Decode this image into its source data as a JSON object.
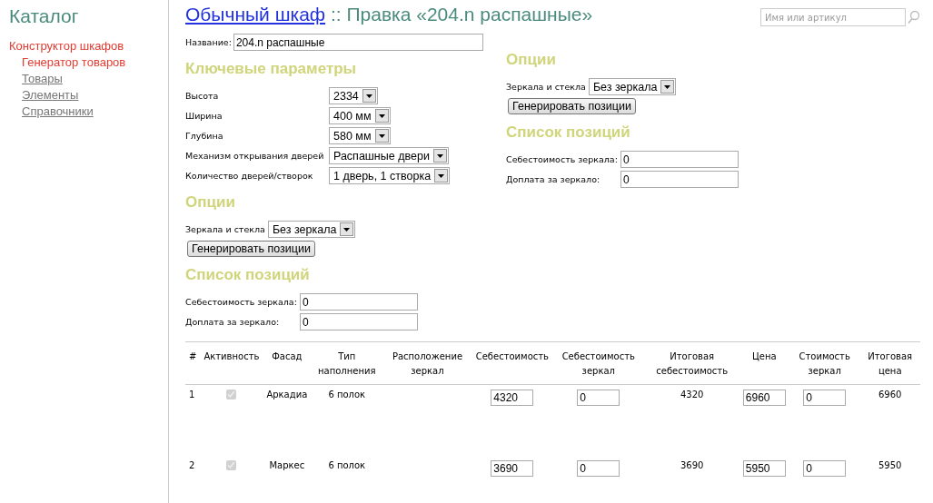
{
  "sidebar": {
    "title": "Каталог",
    "items": [
      {
        "label": "Конструктор шкафов",
        "selected": true,
        "children": [
          {
            "label": "Генератор товаров",
            "selected": true
          },
          {
            "label": "Товары",
            "selected": false
          },
          {
            "label": "Элементы",
            "selected": false
          },
          {
            "label": "Справочники",
            "selected": false
          }
        ]
      }
    ]
  },
  "header": {
    "link": "Обычный шкаф",
    "title": " :: Правка «204.n распашные»"
  },
  "search": {
    "placeholder": "Имя или артикул"
  },
  "name_field": {
    "label": "Название:",
    "value": "204.n распашные"
  },
  "columns": [
    {
      "sections": [
        {
          "heading": "Ключевые параметры",
          "kind": "params",
          "fields": [
            {
              "kind": "select",
              "label": "Высота",
              "value": "2334"
            },
            {
              "kind": "select",
              "label": "Ширина",
              "value": "400 мм"
            },
            {
              "kind": "select",
              "label": "Глубина",
              "value": "580 мм"
            },
            {
              "kind": "select",
              "label": "Механизм открывания дверей",
              "value": "Распашные двери"
            },
            {
              "kind": "select",
              "label": "Количество дверей/створок",
              "value": "1 дверь, 1 створка"
            }
          ]
        },
        {
          "heading": "Опции",
          "kind": "options",
          "fields": [
            {
              "kind": "select",
              "label": "Зеркала и стекла",
              "value": "Без зеркала"
            }
          ],
          "button": "Генерировать позиции"
        },
        {
          "heading": "Список позиций",
          "kind": "costs",
          "fields": [
            {
              "kind": "input",
              "label": "Себестоимость зеркала:",
              "value": "0"
            },
            {
              "kind": "input",
              "label": "Доплата за зеркало:",
              "value": "0"
            }
          ]
        }
      ]
    },
    {
      "sections": [
        {
          "heading": "Опции",
          "kind": "options",
          "fields": [
            {
              "kind": "select",
              "label": "Зеркала и стекла",
              "value": "Без зеркала"
            }
          ],
          "button": "Генерировать позиции"
        },
        {
          "heading": "Список позиций",
          "kind": "costs",
          "fields": [
            {
              "kind": "input",
              "label": "Себестоимость зеркала:",
              "value": "0"
            },
            {
              "kind": "input",
              "label": "Доплата за зеркало:",
              "value": "0"
            }
          ]
        }
      ]
    }
  ],
  "table": {
    "columns": [
      "#",
      "Активность",
      "Фасад",
      "Тип наполнения",
      "Расположение зеркал",
      "Себестоимость",
      "Себестоимость зеркал",
      "Итоговая себестоимость",
      "Цена",
      "Стоимость зеркал",
      "Итоговая цена"
    ],
    "rows": [
      {
        "number": "1",
        "active": true,
        "facade": "Аркадиа",
        "fill": "6 полок",
        "cost": "4320",
        "mirror_cost": "0",
        "total_cost": "4320",
        "price": "6960",
        "mirror_price": "0",
        "total_price": "6960"
      },
      {
        "number": "2",
        "active": true,
        "facade": "Маркес",
        "fill": "6 полок",
        "cost": "3690",
        "mirror_cost": "0",
        "total_cost": "3690",
        "price": "5950",
        "mirror_price": "0",
        "total_price": "5950"
      }
    ]
  }
}
